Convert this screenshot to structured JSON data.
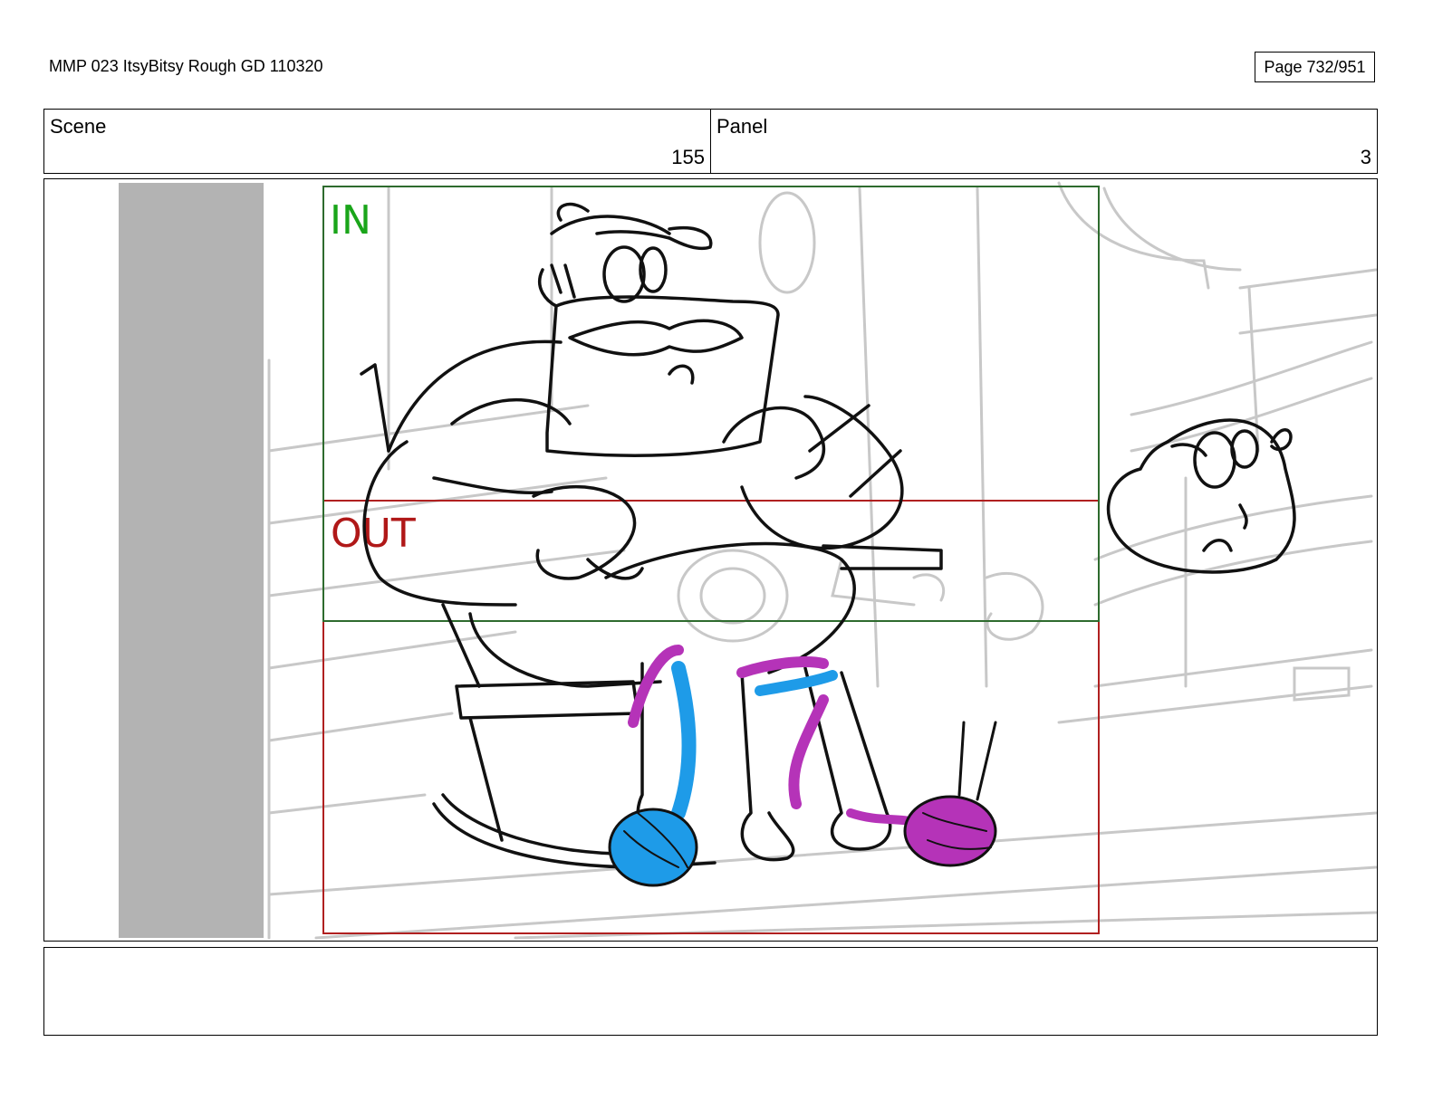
{
  "header": {
    "title": "MMP 023 ItsyBitsy Rough GD 110320",
    "page": "Page 732/951"
  },
  "info": {
    "scene_label": "Scene",
    "scene_value": "155",
    "panel_label": "Panel",
    "panel_value": "3"
  },
  "frame": {
    "in_label": "IN",
    "out_label": "OUT",
    "colors": {
      "in_box": "#2e6b2e",
      "in_text": "#1aa51a",
      "out_box": "#b02020",
      "out_text": "#b01818",
      "yarn_blue": "#1e9be8",
      "yarn_magenta": "#b533b8",
      "mask_gray": "#b3b3b3"
    }
  },
  "notes": {
    "text": ""
  }
}
